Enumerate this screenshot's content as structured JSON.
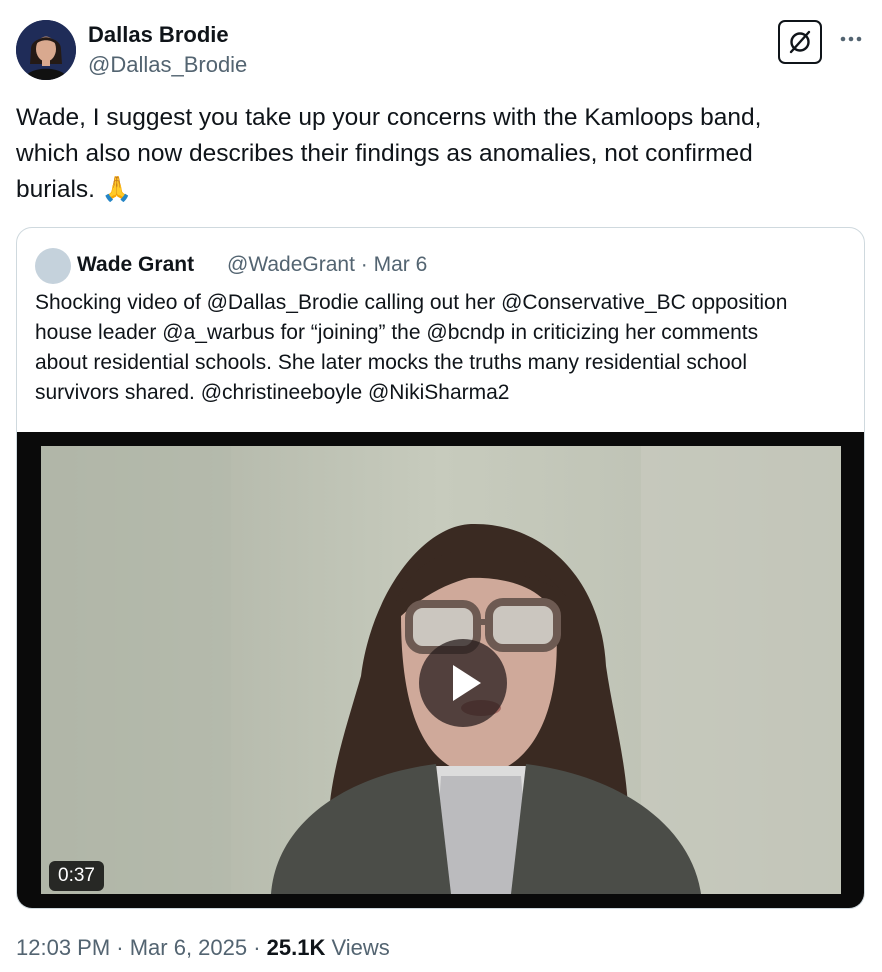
{
  "author": {
    "name": "Dallas Brodie",
    "handle": "@Dallas_Brodie"
  },
  "actions": {
    "grok_icon": "grok-icon",
    "more_icon": "more-icon"
  },
  "tweet": {
    "lines": [
      "Wade, I suggest you take up your concerns with the Kamloops band,",
      "which also now describes their findings as anomalies, not confirmed",
      "burials. 🙏"
    ]
  },
  "quote": {
    "name": "Wade Grant",
    "meta": "@WadeGrant · Mar 6",
    "lines": [
      "Shocking video of @Dallas_Brodie calling out her @Conservative_BC opposition",
      "house leader @a_warbus for “joining” the @bcndp in criticizing her comments",
      "about residential schools. She later mocks the truths many residential school",
      "survivors shared. @christineeboyle @NikiSharma2"
    ],
    "video": {
      "duration": "0:37",
      "play_icon": "play-icon"
    }
  },
  "footer": {
    "time": "12:03 PM · Mar 6, 2025 · ",
    "views_count": "25.1K",
    "views_label": " Views"
  },
  "colors": {
    "text_primary": "#0f1419",
    "text_secondary": "#536471",
    "border": "#cfd9de"
  }
}
